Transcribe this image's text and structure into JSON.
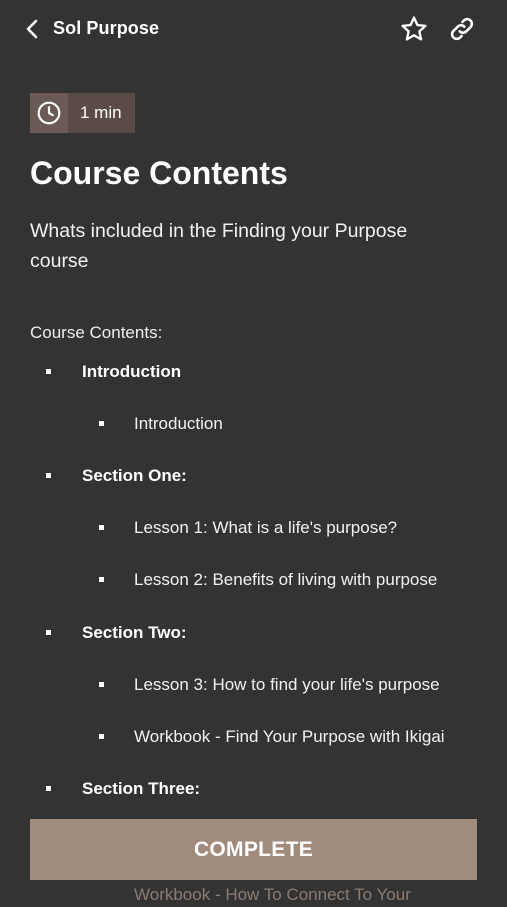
{
  "header": {
    "title": "Sol Purpose",
    "back_icon": "chevron-left-icon",
    "favorite_icon": "star-icon",
    "share_icon": "link-icon"
  },
  "duration": {
    "icon": "clock-icon",
    "label": "1 min"
  },
  "page": {
    "title": "Course Contents",
    "subtitle": "Whats included in the Finding your Purpose course",
    "contents_label": "Course Contents:"
  },
  "outline": {
    "intro_section": "Introduction",
    "intro_lesson": "Introduction",
    "section_one": "Section One:",
    "lesson_1": "Lesson 1: What is a life's purpose?",
    "lesson_2": "Lesson 2: Benefits of living with purpose",
    "section_two": "Section Two:",
    "lesson_3": "Lesson 3: How to find your life's purpose",
    "workbook_1": "Workbook - Find Your Purpose with Ikigai",
    "section_three": "Section Three:",
    "workbook_2_partial": "Workbook - How To Connect To Your"
  },
  "actions": {
    "complete_label": "COMPLETE"
  },
  "colors": {
    "background": "#333333",
    "badge": "#5b4b47",
    "accent_button": "#a08b7d",
    "text": "#ffffff"
  }
}
